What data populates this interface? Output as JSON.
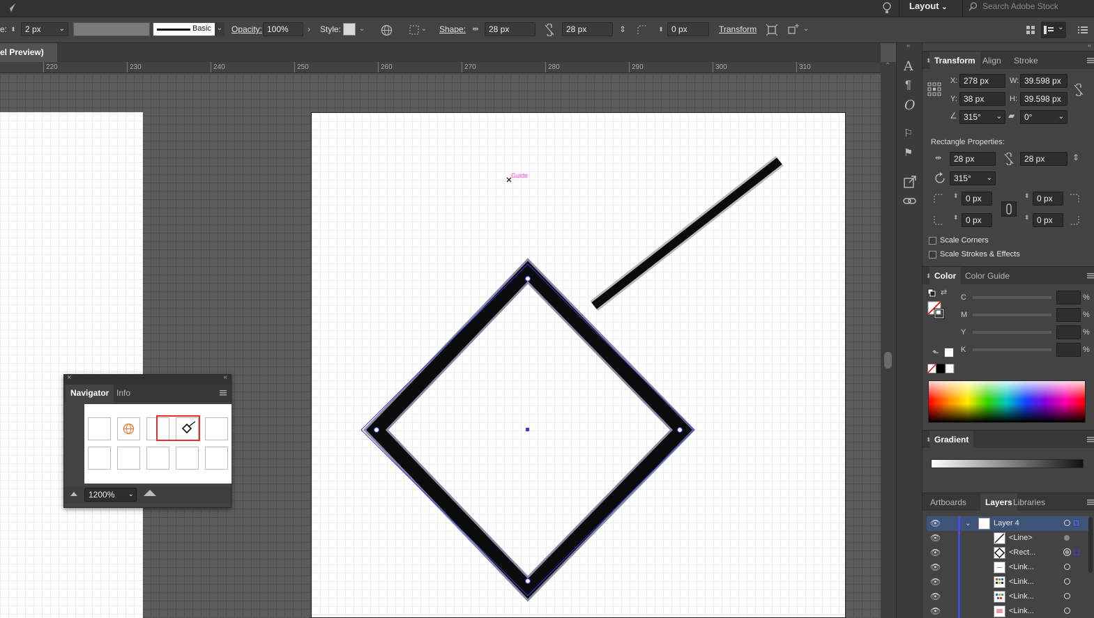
{
  "menubar": {
    "workspace": "Layout",
    "search_placeholder": "Search Adobe Stock"
  },
  "control": {
    "stroke_prefix": "e:",
    "stroke_value": "2 px",
    "stroke_style": "Basic",
    "opacity_label": "Opacity:",
    "opacity_value": "100%",
    "style_label": "Style:",
    "shape_label": "Shape:",
    "shape_w": "28 px",
    "shape_h": "28 px",
    "corner_value": "0 px",
    "transform_label": "Transform"
  },
  "document": {
    "tab_title": "el Preview)",
    "ruler_ticks": [
      "220",
      "230",
      "240",
      "250",
      "260",
      "270",
      "280",
      "290",
      "300",
      "310"
    ]
  },
  "canvas": {
    "guide_label": "Guide"
  },
  "navigator": {
    "tabs": [
      "Navigator",
      "Info"
    ],
    "zoom": "1200%"
  },
  "transform_panel": {
    "tabs": [
      "Transform",
      "Align",
      "Stroke"
    ],
    "x_label": "X:",
    "x": "278 px",
    "y_label": "Y:",
    "y": "38 px",
    "w_label": "W:",
    "w": "39.598 px",
    "h_label": "H:",
    "h": "39.598 px",
    "angle": "315°",
    "shear": "0°",
    "rect_props_label": "Rectangle Properties:",
    "rect_w": "28 px",
    "rect_h": "28 px",
    "rect_angle": "315°",
    "corner_tl": "0 px",
    "corner_tr": "0 px",
    "corner_bl": "0 px",
    "corner_br": "0 px",
    "scale_corners": "Scale Corners",
    "scale_strokes": "Scale Strokes & Effects"
  },
  "color_panel": {
    "tabs": [
      "Color",
      "Color Guide"
    ],
    "channels": [
      "C",
      "M",
      "Y",
      "K"
    ],
    "pct": "%"
  },
  "gradient_panel": {
    "tab": "Gradient"
  },
  "layers_panel": {
    "tabs": [
      "Artboards",
      "Layers",
      "Libraries"
    ],
    "items": [
      {
        "name": "Layer 4"
      },
      {
        "name": "<Line>"
      },
      {
        "name": "<Rect..."
      },
      {
        "name": "<Link..."
      },
      {
        "name": "<Link..."
      },
      {
        "name": "<Link..."
      },
      {
        "name": "<Link..."
      }
    ]
  },
  "colors": {
    "accent": "#4a7dff",
    "selection": "#3a3ad8",
    "guide": "#ff3bd6",
    "nav_frame": "#e82c2c"
  }
}
